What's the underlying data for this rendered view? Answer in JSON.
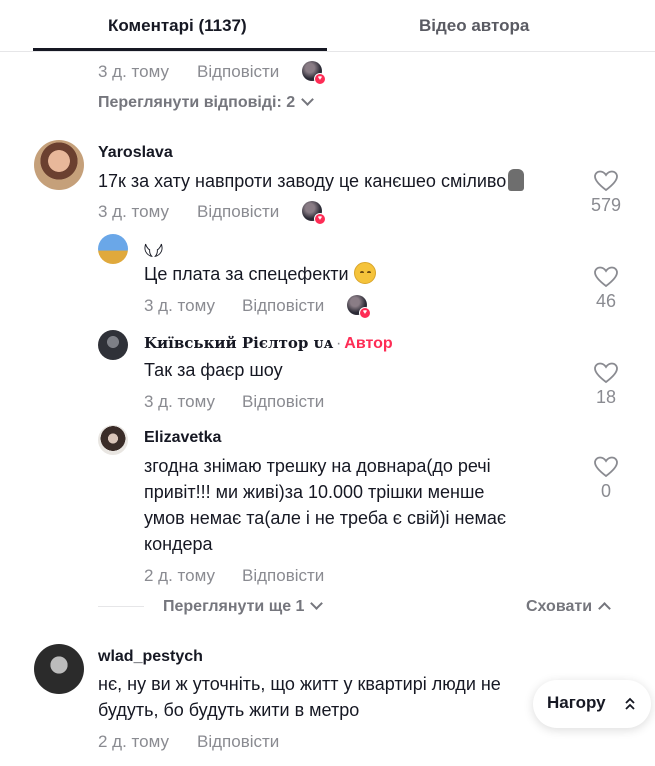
{
  "tabs": {
    "comments_label": "Коментарі (1137)",
    "videos_label": "Відео автора"
  },
  "thread_top": {
    "time": "3 д. тому",
    "reply": "Відповісти",
    "view_replies": "Переглянути відповіді: 2"
  },
  "comments": [
    {
      "username": "Yaroslava",
      "text": "17к за хату навпроти заводу це канєшео сміливо",
      "time": "3 д. тому",
      "reply": "Відповісти",
      "likes": "579",
      "replies": [
        {
          "username": "𓆩𓆪",
          "text": "Це плата за спецефекти",
          "time": "3 д. тому",
          "reply": "Відповісти",
          "likes": "46"
        },
        {
          "username": "𝐊иївський Рієлтор ᴜᴀ",
          "author_sep": "·",
          "author_tag": "Автор",
          "text": "Так за фаєр шоу",
          "time": "3 д. тому",
          "reply": "Відповісти",
          "likes": "18"
        },
        {
          "username": "Elizavetka",
          "text_lines": [
            "згодна знімаю трешку на довнара(до речі",
            "привіт!!! ми живі)за 10.000 трішки менше",
            "умов немає та(але і не треба є свій)і немає",
            "кондера"
          ],
          "time": "2 д. тому",
          "reply": "Відповісти",
          "likes": "0"
        }
      ],
      "view_more": "Переглянути ще 1",
      "hide": "Сховати"
    },
    {
      "username": "wlad_pestych",
      "text_lines": [
        "нє, ну ви ж уточніть, що житт у квартирі люди не",
        "будуть, бо будуть жити в метро"
      ],
      "time": "2 д. тому",
      "reply": "Відповісти"
    }
  ],
  "scroll_top_label": "Нагору",
  "colors": {
    "accent": "#fe2c55",
    "muted": "#8a8b91",
    "text": "#161823"
  }
}
